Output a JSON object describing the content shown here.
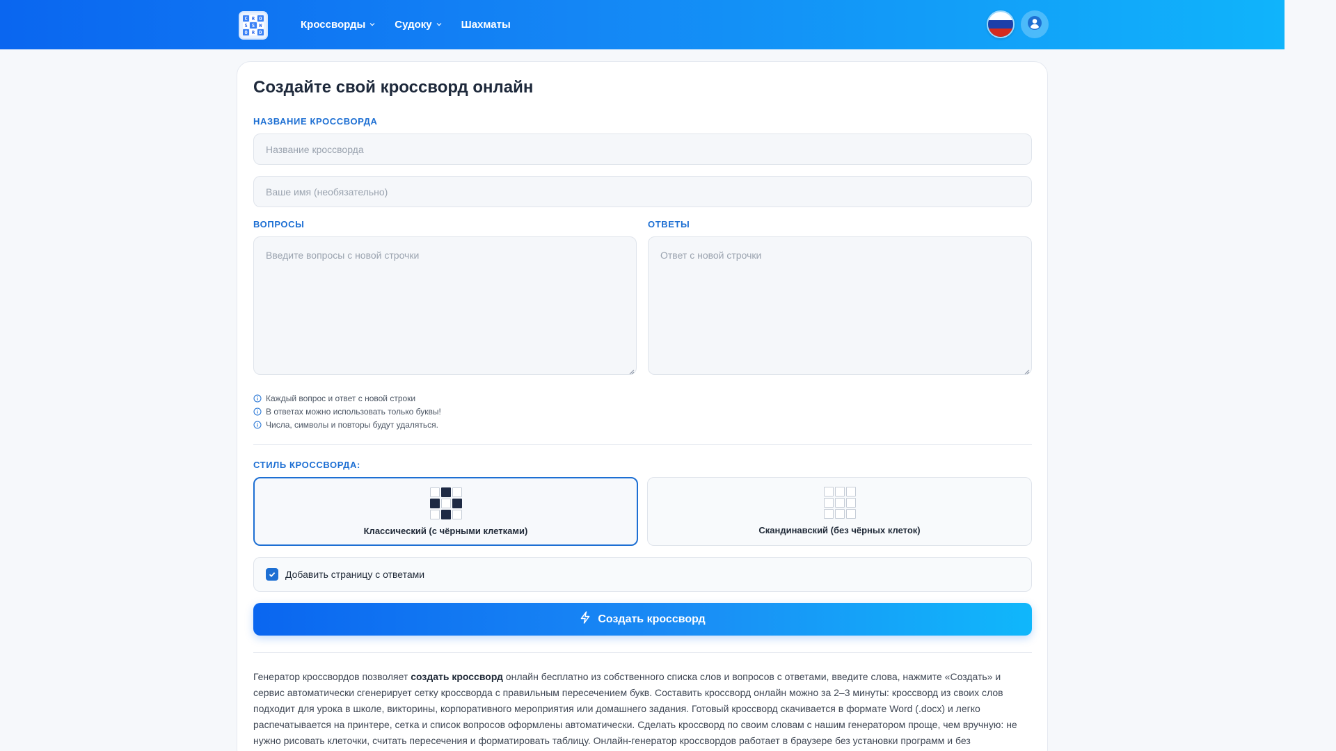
{
  "header": {
    "logo_letters": [
      "C",
      "R",
      "O",
      "S",
      "S",
      "W",
      "O",
      "R",
      "D"
    ],
    "nav": [
      {
        "label": "Кроссворды",
        "has_dropdown": true
      },
      {
        "label": "Судоку",
        "has_dropdown": true
      },
      {
        "label": "Шахматы",
        "has_dropdown": false
      }
    ],
    "language_icon": "russia-flag-icon",
    "user_icon": "user-circle-icon"
  },
  "form": {
    "title": "Создайте свой кроссворд онлайн",
    "name_section_label": "НАЗВАНИЕ КРОССВОРДА",
    "name_placeholder": "Название кроссворда",
    "author_placeholder": "Ваше имя (необязательно)",
    "questions_label": "ВОПРОСЫ",
    "questions_placeholder": "Введите вопросы с новой строчки",
    "answers_label": "ОТВЕТЫ",
    "answers_placeholder": "Ответ с новой строчки",
    "hints": [
      "Каждый вопрос и ответ с новой строки",
      "В ответах можно использовать только буквы!",
      "Числа, символы и повторы будут удаляться."
    ],
    "style_label": "СТИЛЬ КРОССВОРДА:",
    "styles": [
      {
        "label": "Классический (с чёрными клетками)",
        "selected": true
      },
      {
        "label": "Скандинавский (без чёрных клеток)",
        "selected": false
      }
    ],
    "answers_page_checkbox": {
      "label": "Добавить страницу с ответами",
      "checked": true
    },
    "create_button": "Создать кроссворд"
  },
  "description": {
    "before_bold": "Генератор кроссвордов позволяет ",
    "bold": "создать кроссворд",
    "after_bold": " онлайн бесплатно из собственного списка слов и вопросов с ответами, введите слова, нажмите «Создать» и сервис автоматически сгенерирует сетку кроссворда с правильным пересечением букв. Составить кроссворд онлайн можно за 2–3 минуты: кроссворд из своих слов подходит для урока в школе, викторины, корпоративного мероприятия или домашнего задания. Готовый кроссворд скачивается в формате Word (.docx) и легко распечатывается на принтере, сетка и список вопросов оформлены автоматически. Сделать кроссворд по своим словам с нашим генератором проще, чем вручную: не нужно рисовать клеточки, считать пересечения и форматировать таблицу. Онлайн-генератор кроссвордов работает в браузере без установки программ и без"
  },
  "colors": {
    "accent": "#1d6fd3",
    "header_gradient_start": "#0a66f0",
    "header_gradient_end": "#10b4fb"
  }
}
